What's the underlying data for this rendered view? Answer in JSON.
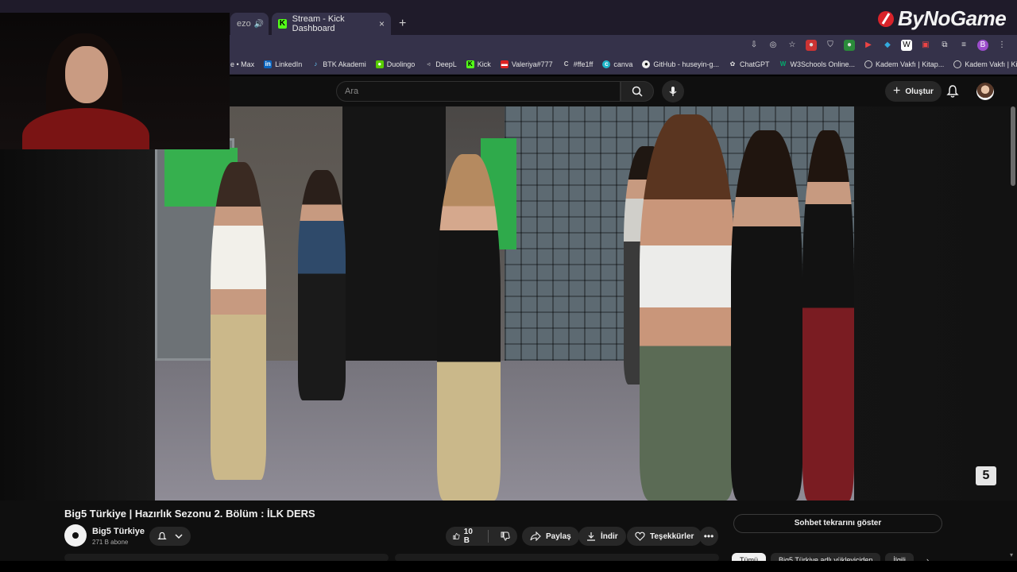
{
  "browser": {
    "tabs": [
      {
        "title": "ezo",
        "icon": "speaker-icon"
      },
      {
        "title": "Stream - Kick Dashboard",
        "icon": "kick-icon",
        "close": "×"
      }
    ],
    "new_tab": "+",
    "bookmarks": [
      {
        "label": "e • Max",
        "icon": "max-icon"
      },
      {
        "label": "LinkedIn",
        "icon": "linkedin-icon"
      },
      {
        "label": "BTK Akademi",
        "icon": "btk-icon"
      },
      {
        "label": "Duolingo",
        "icon": "duolingo-icon"
      },
      {
        "label": "DeepL",
        "icon": "deepl-icon"
      },
      {
        "label": "Kick",
        "icon": "kick-icon"
      },
      {
        "label": "Valeriya#777",
        "icon": "valeriya-icon"
      },
      {
        "label": "#ffe1ff",
        "icon": "color-icon"
      },
      {
        "label": "canva",
        "icon": "canva-icon"
      },
      {
        "label": "GitHub - huseyin-g...",
        "icon": "github-icon"
      },
      {
        "label": "ChatGPT",
        "icon": "chatgpt-icon"
      },
      {
        "label": "W3Schools Online...",
        "icon": "w3schools-icon"
      },
      {
        "label": "Kadem Vakfı | Kitap...",
        "icon": "globe-icon"
      },
      {
        "label": "Kadem Vakfı | Kitap...",
        "icon": "globe-icon"
      }
    ],
    "profile_initial": "B"
  },
  "overlay": {
    "brand": "ByNoGame"
  },
  "youtube": {
    "search_placeholder": "Ara",
    "create_label": "Oluştur",
    "video_title": "Big5 Türkiye | Hazırlık Sezonu 2. Bölüm : İLK DERS",
    "channel_name": "Big5 Türkiye",
    "subscribers": "271 B abone",
    "like_count": "10 B",
    "share_label": "Paylaş",
    "download_label": "İndir",
    "thanks_label": "Teşekkürler",
    "chat_replay_label": "Sohbet tekrarını göster",
    "chips": [
      "Tümü",
      "Big5 Türkiye adlı yükleyiciden",
      "İlgili"
    ],
    "video_watermark": "5"
  },
  "colors": {
    "browser_bg": "#35324a",
    "yt_bg": "#0f0f0f",
    "kick_green": "#53fc18",
    "brand_red": "#d9232a"
  }
}
